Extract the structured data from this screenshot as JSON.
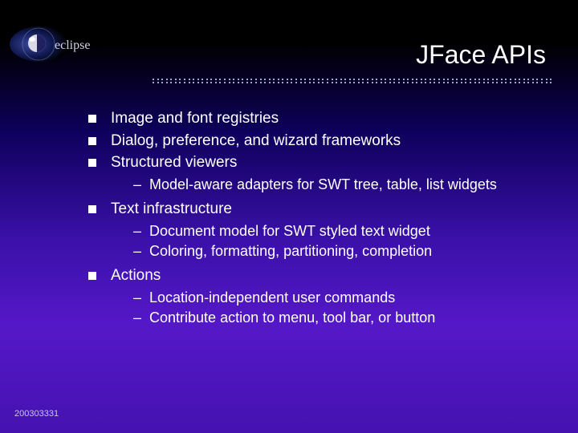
{
  "logo_text": "eclipse",
  "title": "JFace APIs",
  "bullets": [
    {
      "text": "Image and font registries",
      "sub": []
    },
    {
      "text": "Dialog, preference, and wizard frameworks",
      "sub": []
    },
    {
      "text": "Structured viewers",
      "sub": [
        "Model-aware adapters for SWT tree, table, list widgets"
      ]
    },
    {
      "text": "Text infrastructure",
      "sub": [
        "Document model for SWT styled text widget",
        "Coloring, formatting, partitioning, completion"
      ]
    },
    {
      "text": "Actions",
      "sub": [
        "Location-independent user commands",
        "Contribute action to menu, tool bar, or button"
      ]
    }
  ],
  "footer": "200303331"
}
